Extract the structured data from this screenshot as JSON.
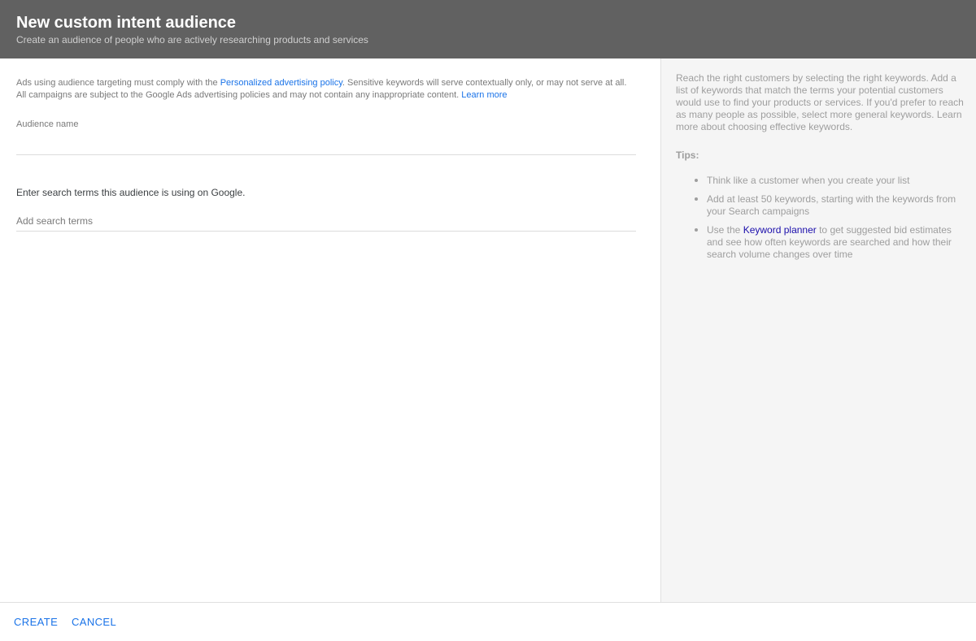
{
  "header": {
    "title": "New custom intent audience",
    "subtitle": "Create an audience of people who are actively researching products and services"
  },
  "policy": {
    "text_before": "Ads using audience targeting must comply with the ",
    "policy_link": "Personalized advertising policy",
    "text_after": ". Sensitive keywords will serve contextually only, or may not serve at all. All campaigns are subject to the Google Ads advertising policies and may not contain any inappropriate content. ",
    "learn_more": "Learn more"
  },
  "audience_name": {
    "label": "Audience name",
    "value": ""
  },
  "search_terms": {
    "heading": "Enter search terms this audience is using on Google.",
    "placeholder": "Add search terms",
    "value": ""
  },
  "side": {
    "intro": "Reach the right customers by selecting the right keywords. Add a list of keywords that match the terms your potential customers would use to find your products or services. If you'd prefer to reach as many people as possible, select more general keywords. Learn more about choosing effective keywords.",
    "tips_label": "Tips:",
    "tip1": "Think like a customer when you create your list",
    "tip2": "Add at least 50 keywords, starting with the keywords from your Search campaigns",
    "tip3_before": "Use the ",
    "tip3_link": "Keyword planner",
    "tip3_after": " to get suggested bid estimates and see how often keywords are searched and how their search volume changes over time"
  },
  "footer": {
    "create_label": "CREATE",
    "cancel_label": "CANCEL"
  },
  "colors": {
    "header_bg": "#616161",
    "link": "#1a73e8",
    "side_bg": "#f5f5f5"
  }
}
